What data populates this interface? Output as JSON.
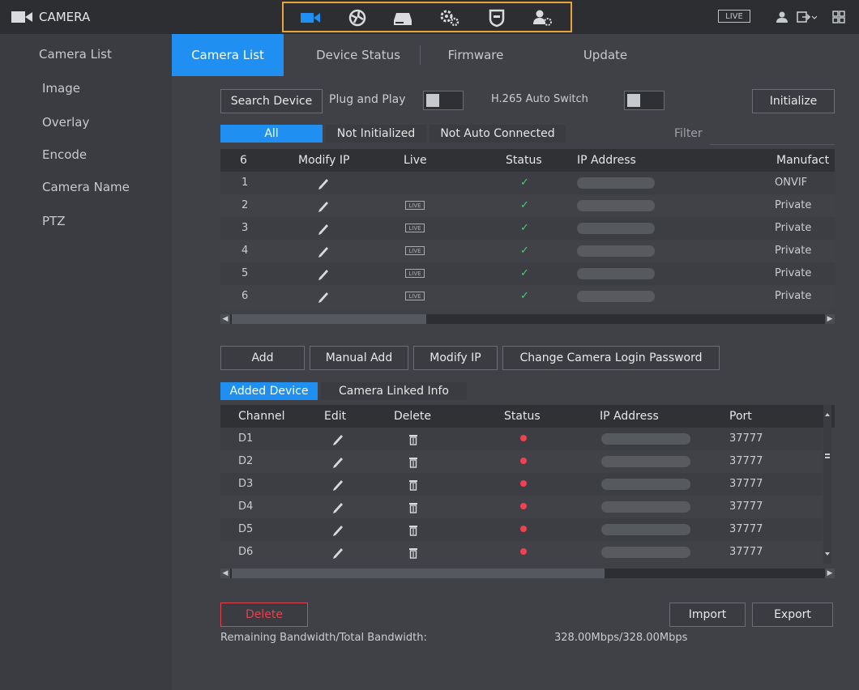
{
  "app": {
    "title": "CAMERA",
    "live_badge": "LIVE"
  },
  "module_bar": {
    "icons": [
      "camera-icon",
      "network-icon",
      "storage-icon",
      "system-icon",
      "security-icon",
      "account-icon"
    ]
  },
  "topbar_right_icons": [
    "user-icon",
    "logout-icon",
    "grid-menu-icon"
  ],
  "sidebar": {
    "items": [
      {
        "label": "Camera List",
        "active": true
      },
      {
        "label": "Image"
      },
      {
        "label": "Overlay"
      },
      {
        "label": "Encode"
      },
      {
        "label": "Camera Name"
      },
      {
        "label": "PTZ"
      }
    ]
  },
  "tabs": [
    {
      "label": "Camera List",
      "active": true
    },
    {
      "label": "Device Status"
    },
    {
      "label": "Firmware"
    },
    {
      "label": "Update"
    }
  ],
  "search": {
    "search_button": "Search Device",
    "plug_and_play_label": "Plug and Play",
    "h265_label": "H.265 Auto Switch",
    "initialize_button": "Initialize"
  },
  "filter": {
    "tabs": [
      "All",
      "Not Initialized",
      "Not Auto Connected"
    ],
    "filter_label": "Filter"
  },
  "search_table": {
    "count": "6",
    "headers": [
      "Modify IP",
      "Live",
      "Status",
      "IP Address",
      "Manufact"
    ],
    "rows": [
      {
        "no": "1",
        "live": "",
        "status": "✓",
        "manufacturer": "ONVIF"
      },
      {
        "no": "2",
        "live": "LIVE",
        "status": "✓",
        "manufacturer": "Private"
      },
      {
        "no": "3",
        "live": "LIVE",
        "status": "✓",
        "manufacturer": "Private"
      },
      {
        "no": "4",
        "live": "LIVE",
        "status": "✓",
        "manufacturer": "Private"
      },
      {
        "no": "5",
        "live": "LIVE",
        "status": "✓",
        "manufacturer": "Private"
      },
      {
        "no": "6",
        "live": "LIVE",
        "status": "✓",
        "manufacturer": "Private"
      }
    ]
  },
  "actions": {
    "add": "Add",
    "manual_add": "Manual Add",
    "modify_ip": "Modify IP",
    "change_password": "Change Camera Login Password"
  },
  "device_tabs": [
    "Added Device",
    "Camera Linked Info"
  ],
  "added_table": {
    "headers": [
      "Channel",
      "Edit",
      "Delete",
      "Status",
      "IP Address",
      "Port"
    ],
    "rows": [
      {
        "channel": "D1",
        "port": "37777"
      },
      {
        "channel": "D2",
        "port": "37777"
      },
      {
        "channel": "D3",
        "port": "37777"
      },
      {
        "channel": "D4",
        "port": "37777"
      },
      {
        "channel": "D5",
        "port": "37777"
      },
      {
        "channel": "D6",
        "port": "37777"
      }
    ]
  },
  "footer": {
    "delete_button": "Delete",
    "import_button": "Import",
    "export_button": "Export",
    "bandwidth_label": "Remaining Bandwidth/Total Bandwidth:",
    "bandwidth_value": "328.00Mbps/328.00Mbps"
  },
  "colors": {
    "accent": "#1f8ff2",
    "highlight": "#e8a33d",
    "status_ok": "#3fd36b",
    "status_offline": "#f2404f"
  }
}
